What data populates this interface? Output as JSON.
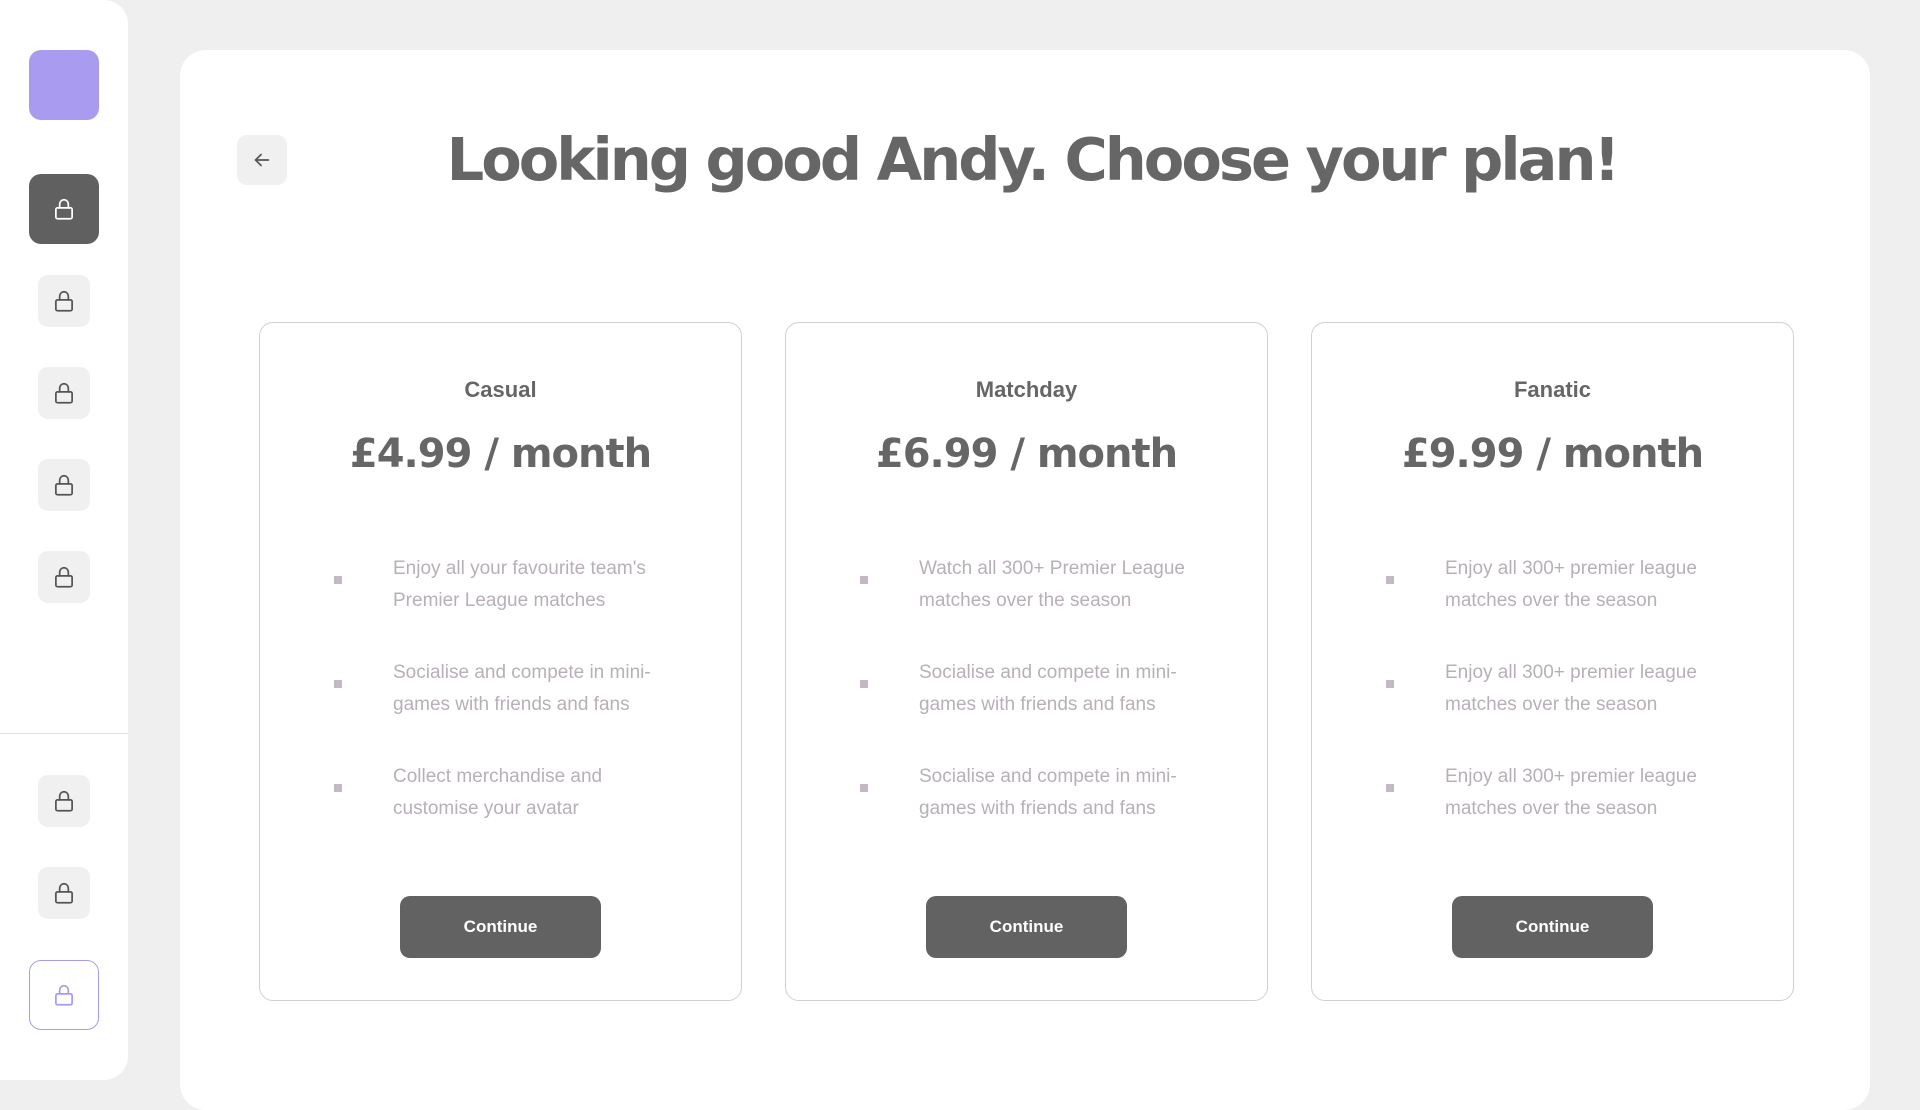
{
  "colors": {
    "brand_accent": "#a99bf0",
    "active_nav": "#606060",
    "button": "#626262",
    "text_dark": "#666666",
    "text_muted": "#b8b0b8"
  },
  "sidebar": {
    "logo_icon": "brand-logo-square",
    "items": [
      {
        "icon": "lock-icon",
        "state": "active"
      },
      {
        "icon": "lock-icon",
        "state": "default"
      },
      {
        "icon": "lock-icon",
        "state": "default"
      },
      {
        "icon": "lock-icon",
        "state": "default"
      },
      {
        "icon": "lock-icon",
        "state": "default"
      }
    ],
    "bottom_items": [
      {
        "icon": "lock-icon",
        "state": "default"
      },
      {
        "icon": "lock-icon",
        "state": "default"
      },
      {
        "icon": "lock-icon",
        "state": "outlined"
      }
    ]
  },
  "header": {
    "back_icon": "arrow-left-icon",
    "title": "Looking good Andy. Choose your plan!"
  },
  "plans": [
    {
      "name": "Casual",
      "price": "£4.99 / month",
      "features": [
        "Enjoy all your favourite team's Premier League matches",
        "Socialise and compete in mini-games with friends and fans",
        "Collect merchandise and customise your avatar"
      ],
      "cta": "Continue"
    },
    {
      "name": "Matchday",
      "price": "£6.99 / month",
      "features": [
        "Watch all 300+ Premier League matches over the season",
        "Socialise and compete in mini-games with friends and fans",
        "Socialise and compete in mini-games with friends and fans"
      ],
      "cta": "Continue"
    },
    {
      "name": "Fanatic",
      "price": "£9.99 / month",
      "features": [
        "Enjoy all 300+ premier league matches over the season",
        "Enjoy all 300+ premier league matches over the season",
        "Enjoy all 300+ premier league matches over the season"
      ],
      "cta": "Continue"
    }
  ]
}
